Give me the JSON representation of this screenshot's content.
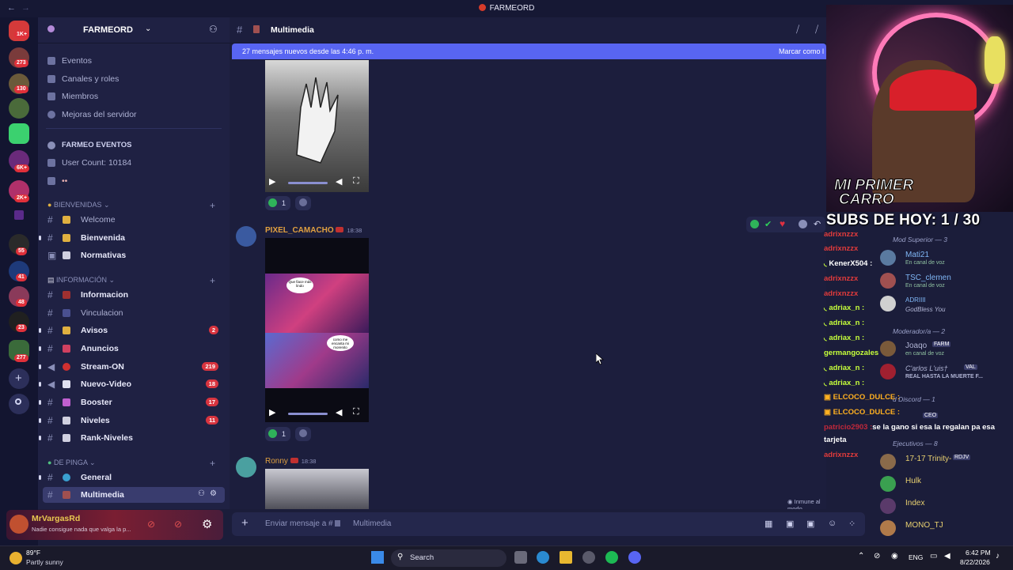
{
  "window": {
    "title": "FARMEORD"
  },
  "server": {
    "name": "FARMEORD"
  },
  "server_rail": {
    "badges": [
      "1K+",
      "273",
      "130",
      "6K+",
      "2K+",
      "55",
      "41",
      "48",
      "23",
      "277"
    ]
  },
  "sidebar": {
    "top_items": [
      "Eventos",
      "Canales y roles",
      "Miembros",
      "Mejoras del servidor"
    ],
    "stats": {
      "title": "FARMEO EVENTOS",
      "user_count": "User Count: 10184"
    },
    "categories": {
      "bienvenidas": "BIENVENIDAS",
      "informacion": "INFORMACIÓN",
      "de_pinga": "DE PINGA"
    },
    "channels_bienvenidas": [
      {
        "label": "Welcome"
      },
      {
        "label": "Bienvenida"
      },
      {
        "label": "Normativas"
      }
    ],
    "channels_info": [
      {
        "label": "Informacion",
        "count": ""
      },
      {
        "label": "Vinculacion",
        "count": ""
      },
      {
        "label": "Avisos",
        "count": "2"
      },
      {
        "label": "Anuncios",
        "count": ""
      },
      {
        "label": "Stream-ON",
        "count": "219"
      },
      {
        "label": "Nuevo-Video",
        "count": "18"
      },
      {
        "label": "Booster",
        "count": "17"
      },
      {
        "label": "Niveles",
        "count": "11"
      },
      {
        "label": "Rank-Niveles",
        "count": ""
      }
    ],
    "channels_pinga": [
      {
        "label": "General"
      },
      {
        "label": "Multimedia"
      }
    ]
  },
  "user_panel": {
    "name": "MrVargasRd",
    "status": "Nadie consigue nada que valga la p..."
  },
  "channel": {
    "name": "Multimedia"
  },
  "new_messages": {
    "text": "27 mensajes nuevos desde las 4:46 p. m.",
    "action": "Marcar como l"
  },
  "messages": [
    {
      "author": "",
      "time": "",
      "reaction_count": "1"
    },
    {
      "author": "PIXEL_CAMACHO",
      "time": "18:38",
      "reaction_count": "1"
    },
    {
      "author": "Ronny",
      "time": "18:38"
    }
  ],
  "video_bubbles": [
    "Que fiace más lindo",
    "como me encanta mi morenito"
  ],
  "paused_notice": "Inmune al modo pausado",
  "composer": {
    "placeholder": "Enviar mensaje a #",
    "channel": "Multimedia"
  },
  "stream_overlay": {
    "car_text_1": "MI PRIMER",
    "car_text_2": "CARRO",
    "subs": "SUBS DE HOY: 1 / 30"
  },
  "stream_chat": [
    {
      "user": "adrixnzzx",
      "msg": "",
      "color": "#e23b3b"
    },
    {
      "user": "adrixnzzx",
      "msg": "",
      "color": "#e23b3b"
    },
    {
      "user": "KenerX504 :",
      "msg": "",
      "color": "#ffffff"
    },
    {
      "user": "adrixnzzx",
      "msg": "",
      "color": "#e23b3b"
    },
    {
      "user": "adrixnzzx",
      "msg": "",
      "color": "#e23b3b"
    },
    {
      "user": "adriax_n :",
      "msg": "",
      "color": "#c6ff3a"
    },
    {
      "user": "adriax_n :",
      "msg": "",
      "color": "#c6ff3a"
    },
    {
      "user": "adriax_n :",
      "msg": "",
      "color": "#c6ff3a"
    },
    {
      "user": "germangozales",
      "msg": "",
      "color": "#c6ff3a"
    },
    {
      "user": "adriax_n :",
      "msg": "",
      "color": "#c6ff3a"
    },
    {
      "user": "adriax_n :",
      "msg": "",
      "color": "#c6ff3a"
    },
    {
      "user": "ELCOCO_DULCE :",
      "msg": "",
      "color": "#ffb020"
    },
    {
      "user": "ELCOCO_DULCE :",
      "msg": "",
      "color": "#ffb020"
    },
    {
      "user": "patricio2903 :",
      "msg": "se la gano si esa la regalan pa esa",
      "color": "#c0283a"
    },
    {
      "user": "",
      "msg": "tarjeta",
      "color": "#ffffff"
    },
    {
      "user": "adrixnzzx",
      "msg": "",
      "color": "#e23b3b"
    }
  ],
  "members": {
    "groups": [
      "Mod Superior — 3",
      "Moderador/a — 2",
      "d Discord — 1",
      "Ejecutivos — 8"
    ],
    "list": [
      {
        "name": "Mati21",
        "sub": "En canal de voz"
      },
      {
        "name": "TSC_clemen",
        "sub": "En canal de voz"
      },
      {
        "name": "ADRIIII",
        "sub": "GodBless You"
      },
      {
        "name": "Joaqo",
        "tag": "FARM",
        "sub": "en canal de voz"
      },
      {
        "name": "C'arlos L'uis†",
        "tag": "VAL",
        "sub": "REAL HASTA LA MUERTE F..."
      },
      {
        "name": "",
        "tag": "CEO",
        "sub": ""
      },
      {
        "name": "17-17 Trinity-",
        "tag": "RDJV",
        "sub": ""
      },
      {
        "name": "Hulk",
        "sub": ""
      },
      {
        "name": "Index",
        "sub": ""
      },
      {
        "name": "MONO_TJ",
        "sub": ""
      }
    ]
  },
  "taskbar": {
    "weather_temp": "89°F",
    "weather_desc": "Partly sunny",
    "search": "Search",
    "lang": "ENG",
    "time": "6:42 PM",
    "date": "8/22/2026"
  },
  "colors": {
    "accent": "#5865f2",
    "bg": "#1c1e3d",
    "sidebar": "#1f2143"
  }
}
